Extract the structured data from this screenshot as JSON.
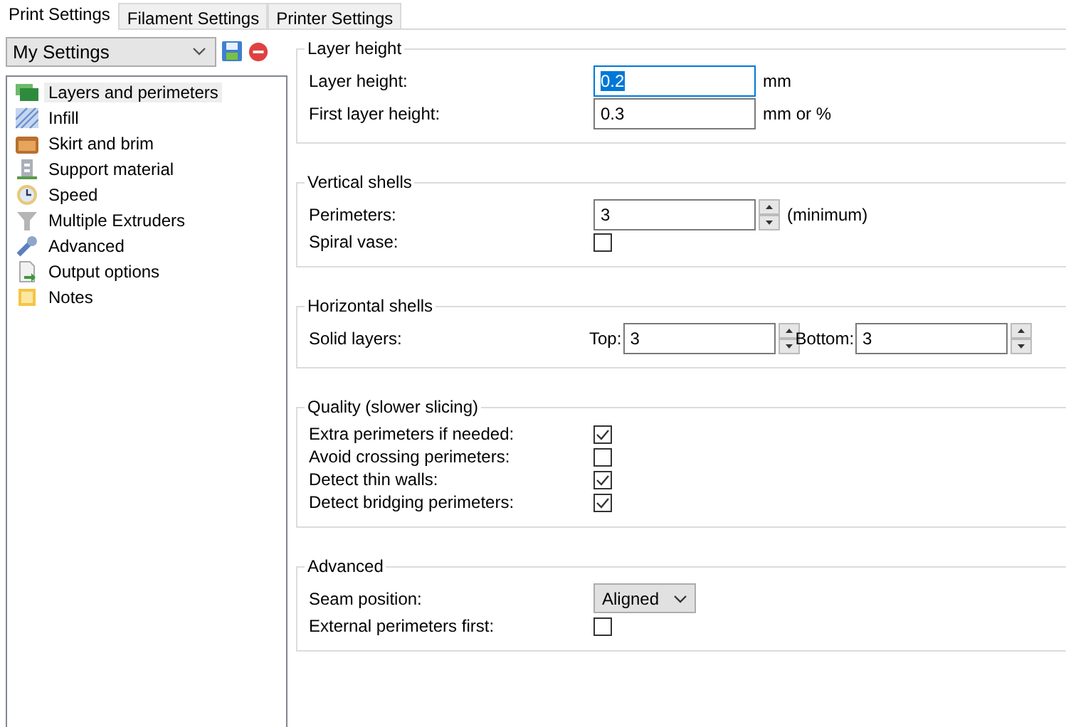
{
  "tabs": [
    {
      "label": "Print Settings",
      "selected": true
    },
    {
      "label": "Filament Settings",
      "selected": false
    },
    {
      "label": "Printer Settings",
      "selected": false
    }
  ],
  "preset": {
    "value": "My Settings"
  },
  "sidebar": {
    "items": [
      {
        "label": "Layers and perimeters",
        "selected": true
      },
      {
        "label": "Infill",
        "selected": false
      },
      {
        "label": "Skirt and brim",
        "selected": false
      },
      {
        "label": "Support material",
        "selected": false
      },
      {
        "label": "Speed",
        "selected": false
      },
      {
        "label": "Multiple Extruders",
        "selected": false
      },
      {
        "label": "Advanced",
        "selected": false
      },
      {
        "label": "Output options",
        "selected": false
      },
      {
        "label": "Notes",
        "selected": false
      }
    ]
  },
  "sections": [
    {
      "title": "Layer height",
      "rows": [
        {
          "kind": "text",
          "label": "Layer height:",
          "value": "0.2",
          "unit": "mm",
          "focused": true
        },
        {
          "kind": "text",
          "label": "First layer height:",
          "value": "0.3",
          "unit": "mm or %",
          "focused": false
        }
      ]
    },
    {
      "title": "Vertical shells",
      "rows": [
        {
          "kind": "spin",
          "label": "Perimeters:",
          "value": "3",
          "unit": "(minimum)"
        },
        {
          "kind": "check",
          "label": "Spiral vase:",
          "checked": false
        }
      ]
    },
    {
      "title": "Horizontal shells",
      "rows": [
        {
          "kind": "pair",
          "label": "Solid layers:",
          "fields": [
            {
              "label": "Top:",
              "value": "3"
            },
            {
              "label": "Bottom:",
              "value": "3"
            }
          ]
        }
      ]
    },
    {
      "title": "Quality (slower slicing)",
      "rows": [
        {
          "kind": "check",
          "label": "Extra perimeters if needed:",
          "checked": true
        },
        {
          "kind": "check",
          "label": "Avoid crossing perimeters:",
          "checked": false
        },
        {
          "kind": "check",
          "label": "Detect thin walls:",
          "checked": true
        },
        {
          "kind": "check",
          "label": "Detect bridging perimeters:",
          "checked": true
        }
      ]
    },
    {
      "title": "Advanced",
      "rows": [
        {
          "kind": "select",
          "label": "Seam position:",
          "value": "Aligned"
        },
        {
          "kind": "check",
          "label": "External perimeters first:",
          "checked": false
        }
      ]
    }
  ]
}
